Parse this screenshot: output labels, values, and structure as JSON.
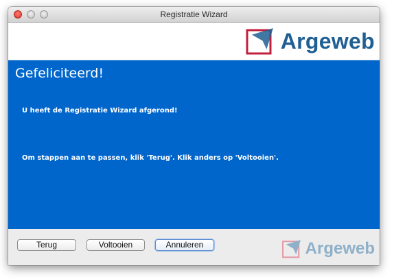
{
  "window": {
    "title": "Registratie Wizard"
  },
  "header": {
    "logo_text": "Argeweb",
    "logo_icon": "argeweb-logo-icon"
  },
  "panel": {
    "title": "Gefeliciteerd!",
    "line1": "U heeft de Registratie Wizard afgerond!",
    "line2": "Om stappen aan te passen, klik 'Terug'. Klik anders op 'Voltooien'."
  },
  "footer": {
    "back_label": "Terug",
    "finish_label": "Voltooien",
    "cancel_label": "Annuleren",
    "logo_text": "Argeweb"
  },
  "colors": {
    "panel_background": "#0066cc",
    "brand": "#1f5f93",
    "brand_faded": "#8fb0c9",
    "logo_red": "#c21f3a"
  }
}
